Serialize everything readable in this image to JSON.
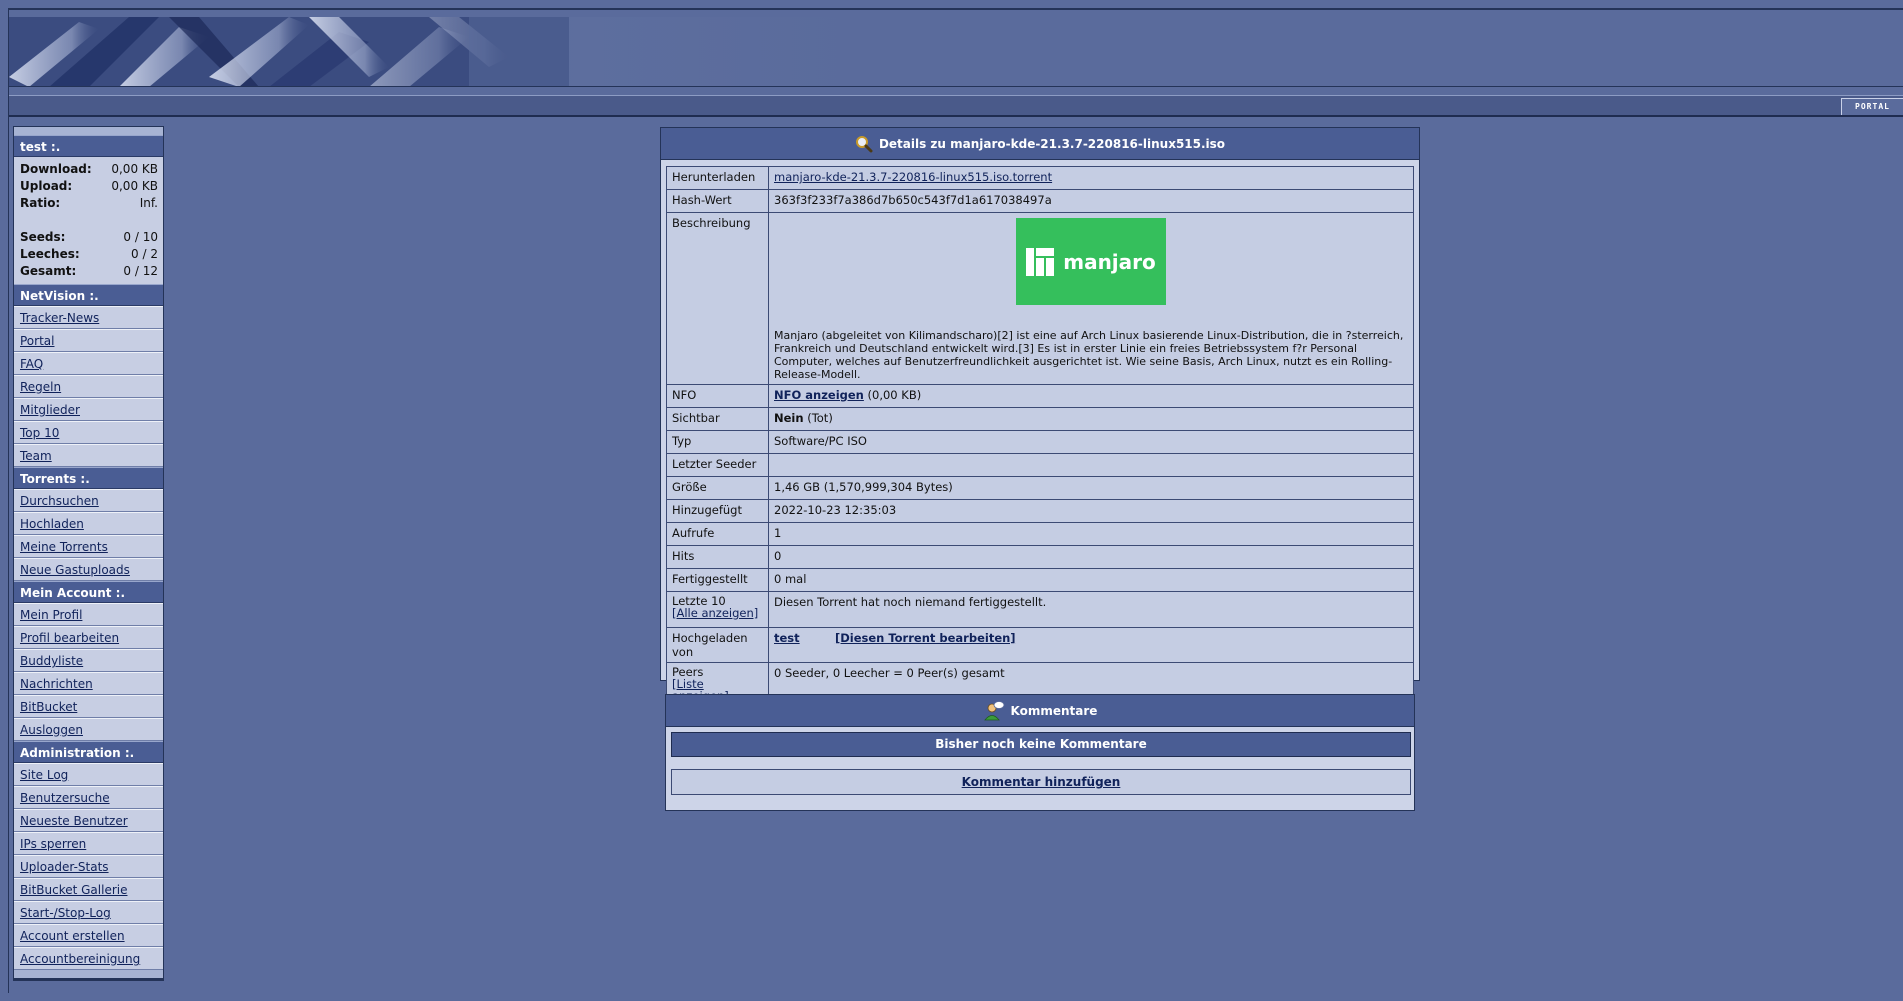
{
  "topnav": {
    "portal_label": "PORTAL"
  },
  "sidebar": {
    "user_title": "test :.",
    "stats": [
      {
        "label": "Download:",
        "value": "0,00 KB"
      },
      {
        "label": "Upload:",
        "value": "0,00 KB"
      },
      {
        "label": "Ratio:",
        "value": "Inf."
      }
    ],
    "stats2": [
      {
        "label": "Seeds:",
        "value": "0 / 10"
      },
      {
        "label": "Leeches:",
        "value": "0 / 2"
      },
      {
        "label": "Gesamt:",
        "value": "0 / 12"
      }
    ],
    "sections": [
      {
        "title": "NetVision :.",
        "items": [
          "Tracker-News",
          "Portal",
          "FAQ",
          "Regeln",
          "Mitglieder",
          "Top 10",
          "Team"
        ]
      },
      {
        "title": "Torrents :.",
        "items": [
          "Durchsuchen",
          "Hochladen",
          "Meine Torrents",
          "Neue Gastuploads"
        ]
      },
      {
        "title": "Mein Account :.",
        "items": [
          "Mein Profil",
          "Profil bearbeiten",
          "Buddyliste",
          "Nachrichten",
          "BitBucket",
          "Ausloggen"
        ]
      },
      {
        "title": "Administration :.",
        "items": [
          "Site Log",
          "Benutzersuche",
          "Neueste Benutzer",
          "IPs sperren",
          "Uploader-Stats",
          "BitBucket Gallerie",
          "Start-/Stop-Log",
          "Account erstellen",
          "Accountbereinigung"
        ]
      }
    ]
  },
  "details": {
    "title": "Details zu manjaro-kde-21.3.7-220816-linux515.iso",
    "download_label": "Herunterladen",
    "download_link": "manjaro-kde-21.3.7-220816-linux515.iso.torrent",
    "hash_label": "Hash-Wert",
    "hash_value": "363f3f233f7a386d7b650c543f7d1a617038497a",
    "desc_label": "Beschreibung",
    "logo_text": "manjaro",
    "desc_text": "Manjaro (abgeleitet von Kilimandscharo)[2] ist eine auf Arch Linux basierende Linux-Distribution, die in ?sterreich, Frankreich und Deutschland entwickelt wird.[3] Es ist in erster Linie ein freies Betriebssystem f?r Personal Computer, welches auf Benutzerfreundlichkeit ausgerichtet ist. Wie seine Basis, Arch Linux, nutzt es ein Rolling-Release-Modell.",
    "nfo_label": "NFO",
    "nfo_link": "NFO anzeigen",
    "nfo_size": "(0,00 KB)",
    "visible_label": "Sichtbar",
    "visible_value": "Nein",
    "visible_note": "(Tot)",
    "type_label": "Typ",
    "type_value": "Software/PC ISO",
    "last_seeder_label": "Letzter Seeder",
    "last_seeder_value": "",
    "size_label": "Größe",
    "size_value": "1,46 GB (1,570,999,304 Bytes)",
    "added_label": "Hinzugefügt",
    "added_value": "2022-10-23 12:35:03",
    "views_label": "Aufrufe",
    "views_value": "1",
    "hits_label": "Hits",
    "hits_value": "0",
    "completed_label": "Fertiggestellt",
    "completed_value": "0 mal",
    "last10_label": "Letzte 10",
    "last10_show_all": "[Alle anzeigen]",
    "last10_value": "Diesen Torrent hat noch niemand fertiggestellt.",
    "uploader_label": "Hochgeladen von",
    "uploader_name": "test",
    "edit_link": "[Diesen Torrent bearbeiten]",
    "peers_label": "Peers",
    "peers_list_link": "[Liste anzeigen]",
    "peers_value": "0 Seeder, 0 Leecher = 0 Peer(s) gesamt"
  },
  "comments": {
    "title": "Kommentare",
    "no_comments": "Bisher noch keine Kommentare",
    "add_comment": "Kommentar hinzufügen"
  },
  "colors": {
    "page_bg": "#5a6b9c",
    "header_bg": "#4a5d94",
    "cell_bg": "#c5cde3",
    "manjaro_green": "#35bf5c"
  }
}
